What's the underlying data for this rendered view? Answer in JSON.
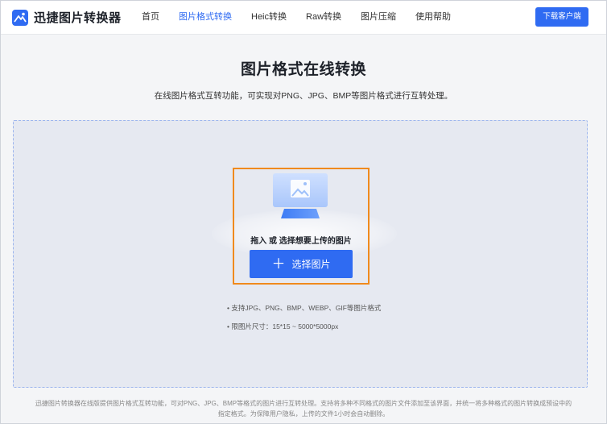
{
  "header": {
    "logo_text": "迅捷图片转换器",
    "nav": [
      {
        "label": "首页"
      },
      {
        "label": "图片格式转换"
      },
      {
        "label": "Heic转换"
      },
      {
        "label": "Raw转换"
      },
      {
        "label": "图片压缩"
      },
      {
        "label": "使用帮助"
      }
    ],
    "download_label": "下载客户端"
  },
  "main": {
    "title": "图片格式在线转换",
    "subtitle": "在线图片格式互转功能，可实现对PNG、JPG、BMP等图片格式进行互转处理。",
    "upload": {
      "hint": "拖入 或 选择想要上传的图片",
      "button_label": "选择图片"
    },
    "tips": [
      "• 支持JPG、PNG、BMP、WEBP、GIF等图片格式",
      "• 限图片尺寸：15*15 ~ 5000*5000px"
    ]
  },
  "footer": {
    "note": "迅捷图片转换器在线版提供图片格式互转功能，可对PNG、JPG、BMP等格式的图片进行互转处理。支持将多种不同格式的图片文件添加至该界面，并统一将多种格式的图片转换成预设中的指定格式。为保障用户隐私，上传的文件1小时会自动删除。"
  },
  "colors": {
    "accent": "#2f6bf2",
    "upload_border": "#f08a1d",
    "dropzone_bg": "#e6e9f1"
  }
}
